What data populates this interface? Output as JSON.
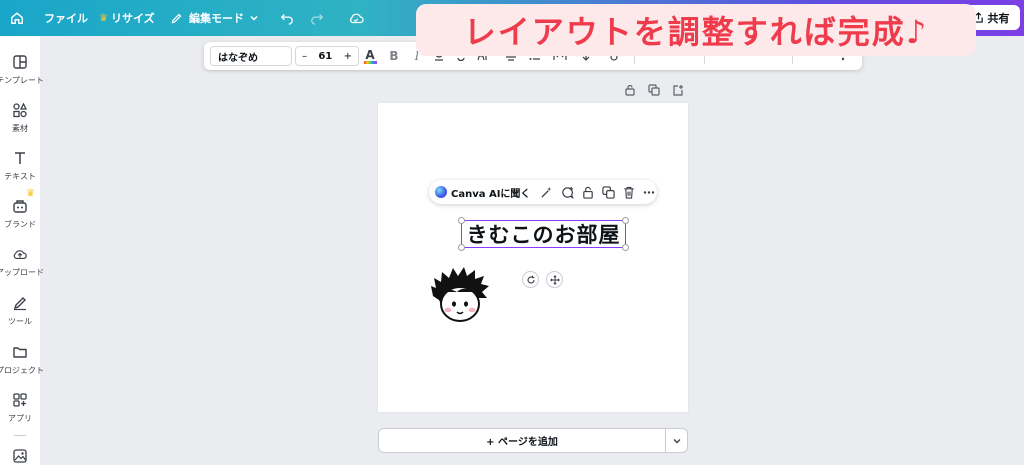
{
  "topbar": {
    "file_label": "ファイル",
    "resize_label": "リサイズ",
    "edit_mode_label": "編集モード",
    "share_label": "共有"
  },
  "banner": {
    "text": "レイアウトを調整すれば完成♪"
  },
  "sidebar": {
    "items": [
      {
        "label": "テンプレート",
        "icon": "template-icon"
      },
      {
        "label": "素材",
        "icon": "elements-icon"
      },
      {
        "label": "テキスト",
        "icon": "text-icon"
      },
      {
        "label": "ブランド",
        "icon": "brand-icon"
      },
      {
        "label": "アップロード",
        "icon": "upload-icon"
      },
      {
        "label": "ツール",
        "icon": "tools-icon"
      },
      {
        "label": "プロジェクト",
        "icon": "projects-icon"
      },
      {
        "label": "アプリ",
        "icon": "apps-icon"
      }
    ]
  },
  "toolbar": {
    "font_name": "はなぞめ",
    "font_size": "61",
    "minus": "–",
    "plus": "+",
    "bold": "B",
    "italic": "I"
  },
  "context_menu": {
    "ai_label": "Canva AIに聞く"
  },
  "canvas": {
    "text": "きむこのお部屋"
  },
  "add_page": {
    "label": "+ ページを追加"
  },
  "colors": {
    "accent": "#8b3dff",
    "banner_text": "#ee3c4d",
    "banner_bg": "#fde9ea"
  }
}
